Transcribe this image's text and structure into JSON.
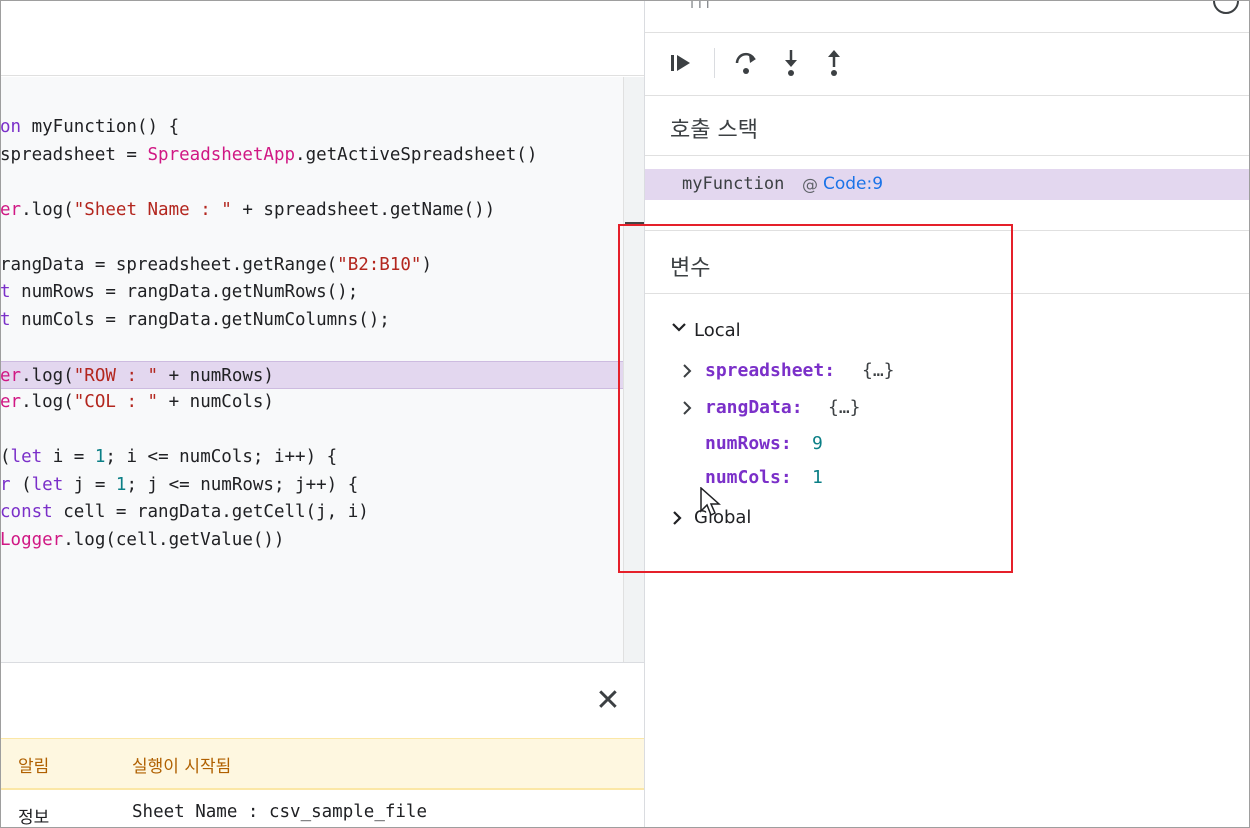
{
  "editor": {
    "lines": [
      {
        "kind": "plain",
        "parts": [
          {
            "t": "on",
            "c": "kw"
          },
          {
            "t": " myFunction() {",
            "c": ""
          }
        ]
      },
      {
        "kind": "plain",
        "parts": [
          {
            "t": "spreadsheet = ",
            "c": ""
          },
          {
            "t": "SpreadsheetApp",
            "c": "cls"
          },
          {
            "t": ".getActiveSpreadsheet()",
            "c": ""
          }
        ]
      },
      {
        "kind": "blank",
        "parts": []
      },
      {
        "kind": "plain",
        "parts": [
          {
            "t": "er",
            "c": "cls"
          },
          {
            "t": ".log(",
            "c": ""
          },
          {
            "t": "\"Sheet Name : \"",
            "c": "str"
          },
          {
            "t": " + spreadsheet.getName())",
            "c": ""
          }
        ]
      },
      {
        "kind": "blank",
        "parts": []
      },
      {
        "kind": "plain",
        "parts": [
          {
            "t": "rangData = spreadsheet.getRange(",
            "c": ""
          },
          {
            "t": "\"B2:B10\"",
            "c": "str"
          },
          {
            "t": ")",
            "c": ""
          }
        ]
      },
      {
        "kind": "plain",
        "parts": [
          {
            "t": "t",
            "c": "kw"
          },
          {
            "t": " numRows = rangData.getNumRows();",
            "c": ""
          }
        ]
      },
      {
        "kind": "plain",
        "parts": [
          {
            "t": "t",
            "c": "kw"
          },
          {
            "t": " numCols = rangData.getNumColumns();",
            "c": ""
          }
        ]
      },
      {
        "kind": "blank",
        "parts": []
      },
      {
        "kind": "highlight",
        "parts": [
          {
            "t": "er",
            "c": "cls"
          },
          {
            "t": ".log(",
            "c": ""
          },
          {
            "t": "\"ROW : \"",
            "c": "str"
          },
          {
            "t": " + numRows)",
            "c": ""
          }
        ]
      },
      {
        "kind": "plain",
        "parts": [
          {
            "t": "er",
            "c": "cls"
          },
          {
            "t": ".log(",
            "c": ""
          },
          {
            "t": "\"COL : \"",
            "c": "str"
          },
          {
            "t": " + numCols)",
            "c": ""
          }
        ]
      },
      {
        "kind": "blank",
        "parts": []
      },
      {
        "kind": "plain",
        "parts": [
          {
            "t": "(",
            "c": ""
          },
          {
            "t": "let",
            "c": "kw"
          },
          {
            "t": " i = ",
            "c": ""
          },
          {
            "t": "1",
            "c": "num"
          },
          {
            "t": "; i <= numCols; i++) {",
            "c": ""
          }
        ]
      },
      {
        "kind": "plain",
        "parts": [
          {
            "t": "r",
            "c": "kw"
          },
          {
            "t": " (",
            "c": ""
          },
          {
            "t": "let",
            "c": "kw"
          },
          {
            "t": " j = ",
            "c": ""
          },
          {
            "t": "1",
            "c": "num"
          },
          {
            "t": "; j <= numRows; j++) {",
            "c": ""
          }
        ]
      },
      {
        "kind": "plain",
        "parts": [
          {
            "t": "const",
            "c": "kw"
          },
          {
            "t": " cell = rangData.getCell(j, i)",
            "c": ""
          }
        ]
      },
      {
        "kind": "plain",
        "parts": [
          {
            "t": "Logger",
            "c": "cls"
          },
          {
            "t": ".log(cell.getValue())",
            "c": ""
          }
        ]
      }
    ]
  },
  "log": {
    "close_icon": "close-icon",
    "header": {
      "type": "알림",
      "message": "실행이 시작됨"
    },
    "rows": [
      {
        "type": "정보",
        "message": "Sheet Name : csv_sample_file"
      }
    ]
  },
  "debugger": {
    "top_marks": "| | |",
    "toolbar": {
      "resume_icon": "resume-icon",
      "step_over_icon": "step-over-icon",
      "step_into_icon": "step-into-icon",
      "step_out_icon": "step-out-icon"
    },
    "call_stack": {
      "title": "호출 스택",
      "frames": [
        {
          "function": "myFunction",
          "at": "@",
          "location": "Code:9"
        }
      ]
    },
    "variables": {
      "title": "변수",
      "scopes": [
        {
          "name": "Local",
          "expanded": true
        },
        {
          "name": "Global",
          "expanded": false
        }
      ],
      "locals": [
        {
          "name": "spreadsheet:",
          "value": "{…}",
          "expandable": true
        },
        {
          "name": "rangData:",
          "value": "{…}",
          "expandable": true
        },
        {
          "name": "numRows:",
          "value": "9",
          "expandable": false
        },
        {
          "name": "numCols:",
          "value": "1",
          "expandable": false
        }
      ]
    }
  },
  "colors": {
    "highlight": "#e3d7ef",
    "keyword": "#7b30c9",
    "string": "#b3261e",
    "class": "#d01884",
    "number": "#0b7f86",
    "link": "#1a73e8",
    "annotation": "#e5202a"
  }
}
